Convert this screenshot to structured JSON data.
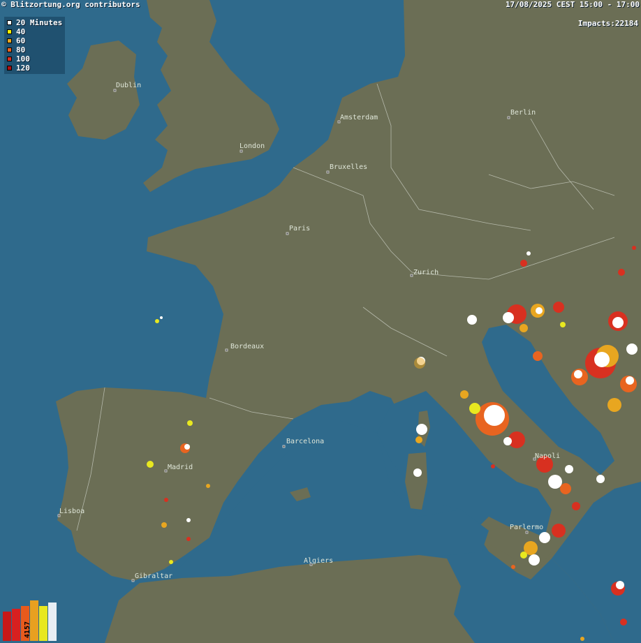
{
  "header": {
    "attribution": "© Blitzortung.org contributors",
    "time_range": "17/08/2025 CEST 15:00 - 17:00",
    "impacts_label": "Impacts:22184"
  },
  "legend": [
    {
      "label": "20 Minutes",
      "color": "#ffffff"
    },
    {
      "label": "40",
      "color": "#f5f100"
    },
    {
      "label": "60",
      "color": "#e8a620"
    },
    {
      "label": "80",
      "color": "#e86420"
    },
    {
      "label": "100",
      "color": "#d83020"
    },
    {
      "label": "120",
      "color": "#b01010"
    }
  ],
  "histogram": {
    "count_label": "4157",
    "bars": [
      {
        "color": "#c81818",
        "fraction": 0.72
      },
      {
        "color": "#d82020",
        "fraction": 0.8
      },
      {
        "color": "#e85a1c",
        "fraction": 0.86
      },
      {
        "color": "#e8a020",
        "fraction": 1.0
      },
      {
        "color": "#e8e820",
        "fraction": 0.86
      },
      {
        "color": "#e8eef4",
        "fraction": 0.94
      }
    ]
  },
  "cities": [
    {
      "name": "Dublin",
      "id": "dublin"
    },
    {
      "name": "London",
      "id": "london"
    },
    {
      "name": "Amsterdam",
      "id": "amsterdam"
    },
    {
      "name": "Berlin",
      "id": "berlin"
    },
    {
      "name": "Bruxelles",
      "id": "bruxelles"
    },
    {
      "name": "Paris",
      "id": "paris"
    },
    {
      "name": "Zurich",
      "id": "zurich"
    },
    {
      "name": "Bordeaux",
      "id": "bordeaux"
    },
    {
      "name": "Barcelona",
      "id": "barcelona"
    },
    {
      "name": "Madrid",
      "id": "madrid"
    },
    {
      "name": "Lisboa",
      "id": "lisboa"
    },
    {
      "name": "Algiers",
      "id": "algiers"
    },
    {
      "name": "Gibraltar",
      "id": "gibraltar"
    },
    {
      "name": "Napoli",
      "id": "napoli"
    },
    {
      "name": "Parlermo",
      "id": "palermo"
    }
  ],
  "colors": {
    "sea": "#2f6a8c",
    "land": "#6b6e55",
    "border": "#c8ccc0",
    "river": "#3f6a6e"
  }
}
